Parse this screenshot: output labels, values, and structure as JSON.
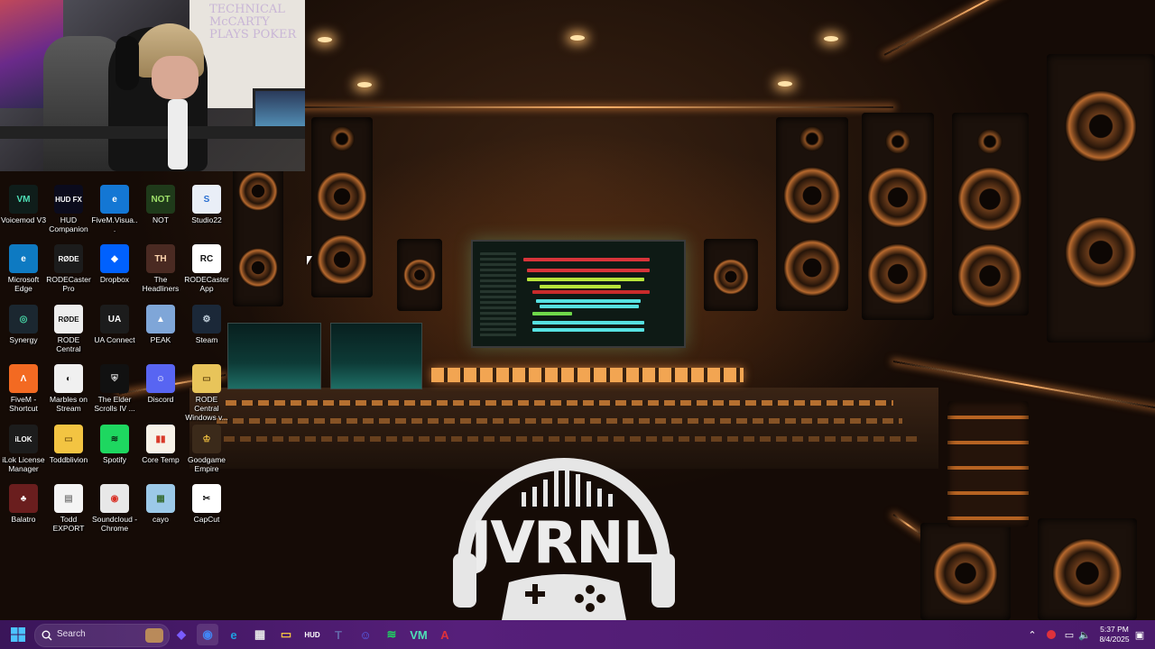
{
  "desktop": {
    "icons": [
      {
        "label": "Voicemod V3",
        "glyph": "VM",
        "color": "#0f1d1a",
        "fg": "#4ee0b6",
        "badge": ""
      },
      {
        "label": "HUD Companion",
        "glyph": "HUD FX",
        "color": "#0b0b1c",
        "fg": "#ffffff",
        "badge": ""
      },
      {
        "label": "FiveM.Visua...",
        "glyph": "e",
        "color": "#1477d4",
        "fg": "#ffffff",
        "badge": "ok"
      },
      {
        "label": "NOT",
        "glyph": "NOT",
        "color": "#1f3a1a",
        "fg": "#9fe06a",
        "badge": "ok"
      },
      {
        "label": "Studio22",
        "glyph": "S",
        "color": "#e9eef7",
        "fg": "#2a6fd1",
        "badge": "bad"
      },
      {
        "label": "Microsoft Edge",
        "glyph": "e",
        "color": "#0e7ac2",
        "fg": "#ffffff",
        "badge": ""
      },
      {
        "label": "RODECaster Pro",
        "glyph": "RØDE",
        "color": "#1c1c1c",
        "fg": "#ffffff",
        "badge": ""
      },
      {
        "label": "Dropbox",
        "glyph": "◆",
        "color": "#0061fe",
        "fg": "#ffffff",
        "badge": ""
      },
      {
        "label": "The Headliners",
        "glyph": "TH",
        "color": "#4a2a22",
        "fg": "#ffd7b0",
        "badge": "bad"
      },
      {
        "label": "RODECaster App",
        "glyph": "RC",
        "color": "#ffffff",
        "fg": "#111111",
        "badge": ""
      },
      {
        "label": "Synergy",
        "glyph": "◎",
        "color": "#1b2730",
        "fg": "#47d6a6",
        "badge": ""
      },
      {
        "label": "RODE Central",
        "glyph": "RØDE",
        "color": "#eeeeee",
        "fg": "#111111",
        "badge": ""
      },
      {
        "label": "UA Connect",
        "glyph": "UA",
        "color": "#1c1c1c",
        "fg": "#ffffff",
        "badge": ""
      },
      {
        "label": "PEAK",
        "glyph": "▲",
        "color": "#7fa6d8",
        "fg": "#ffffff",
        "badge": "bad"
      },
      {
        "label": "Steam",
        "glyph": "⚙",
        "color": "#1b2838",
        "fg": "#c7d5e0",
        "badge": ""
      },
      {
        "label": "FiveM - Shortcut",
        "glyph": "Λ",
        "color": "#f36a22",
        "fg": "#ffffff",
        "badge": ""
      },
      {
        "label": "Marbles on Stream",
        "glyph": "◐",
        "color": "#f0f0f0",
        "fg": "#222222",
        "badge": "ok"
      },
      {
        "label": "The Elder Scrolls IV ...",
        "glyph": "⛨",
        "color": "#111111",
        "fg": "#dddddd",
        "badge": "bad"
      },
      {
        "label": "Discord",
        "glyph": "☺",
        "color": "#5865f2",
        "fg": "#ffffff",
        "badge": "bad"
      },
      {
        "label": "RODE Central Windows v...",
        "glyph": "▭",
        "color": "#e8c45a",
        "fg": "#6b4e12",
        "badge": ""
      },
      {
        "label": "iLok License Manager",
        "glyph": "iLOK",
        "color": "#1c1c1c",
        "fg": "#ffffff",
        "badge": ""
      },
      {
        "label": "Toddblivion",
        "glyph": "▭",
        "color": "#f3c442",
        "fg": "#8a6414",
        "badge": ""
      },
      {
        "label": "Spotify",
        "glyph": "≋",
        "color": "#1ed760",
        "fg": "#0b2b14",
        "badge": ""
      },
      {
        "label": "Core Temp",
        "glyph": "▮▮",
        "color": "#f7f2e8",
        "fg": "#d93a2a",
        "badge": "ok"
      },
      {
        "label": "Goodgame Empire",
        "glyph": "♔",
        "color": "#3b2a1a",
        "fg": "#f0c040",
        "badge": "ok"
      },
      {
        "label": "Balatro",
        "glyph": "♣",
        "color": "#6a1e1e",
        "fg": "#ffffff",
        "badge": "bad"
      },
      {
        "label": "Todd EXPORT",
        "glyph": "▤",
        "color": "#f4f4f4",
        "fg": "#888888",
        "badge": ""
      },
      {
        "label": "Soundcloud - Chrome",
        "glyph": "◉",
        "color": "#e8e8e8",
        "fg": "#d93025",
        "badge": ""
      },
      {
        "label": "cayo",
        "glyph": "▦",
        "color": "#9cc9e8",
        "fg": "#3a6f3a",
        "badge": "ok"
      },
      {
        "label": "CapCut",
        "glyph": "✂",
        "color": "#ffffff",
        "fg": "#111111",
        "badge": ""
      }
    ],
    "wallpaper_logo": "JVRNL",
    "wallpaper_sign": "TECHNICAL McCARTY PLAYS POKER"
  },
  "taskbar": {
    "search_placeholder": "Search",
    "clock_time": "5:37 PM",
    "clock_date": "8/4/2025",
    "apps": [
      {
        "name": "copilot-icon",
        "glyph": "◆",
        "color": "#7a5cff"
      },
      {
        "name": "chrome-icon",
        "glyph": "◉",
        "color": "#4285f4"
      },
      {
        "name": "edge-icon",
        "glyph": "e",
        "color": "#1fa0e0"
      },
      {
        "name": "store-icon",
        "glyph": "▦",
        "color": "#e8e8e8"
      },
      {
        "name": "explorer-icon",
        "glyph": "▭",
        "color": "#f3c442"
      },
      {
        "name": "hud-fx-icon",
        "glyph": "HUD",
        "color": "#ffffff"
      },
      {
        "name": "teams-icon",
        "glyph": "T",
        "color": "#6264a7"
      },
      {
        "name": "discord-icon",
        "glyph": "☺",
        "color": "#5865f2"
      },
      {
        "name": "spotify-icon",
        "glyph": "≋",
        "color": "#1ed760"
      },
      {
        "name": "voicemod-icon",
        "glyph": "VM",
        "color": "#4ee0b6"
      },
      {
        "name": "app-red-icon",
        "glyph": "A",
        "color": "#e0313b"
      }
    ]
  },
  "colors": {
    "taskbar": "#4a1a6b",
    "accent_orange": "#ffb36a"
  }
}
